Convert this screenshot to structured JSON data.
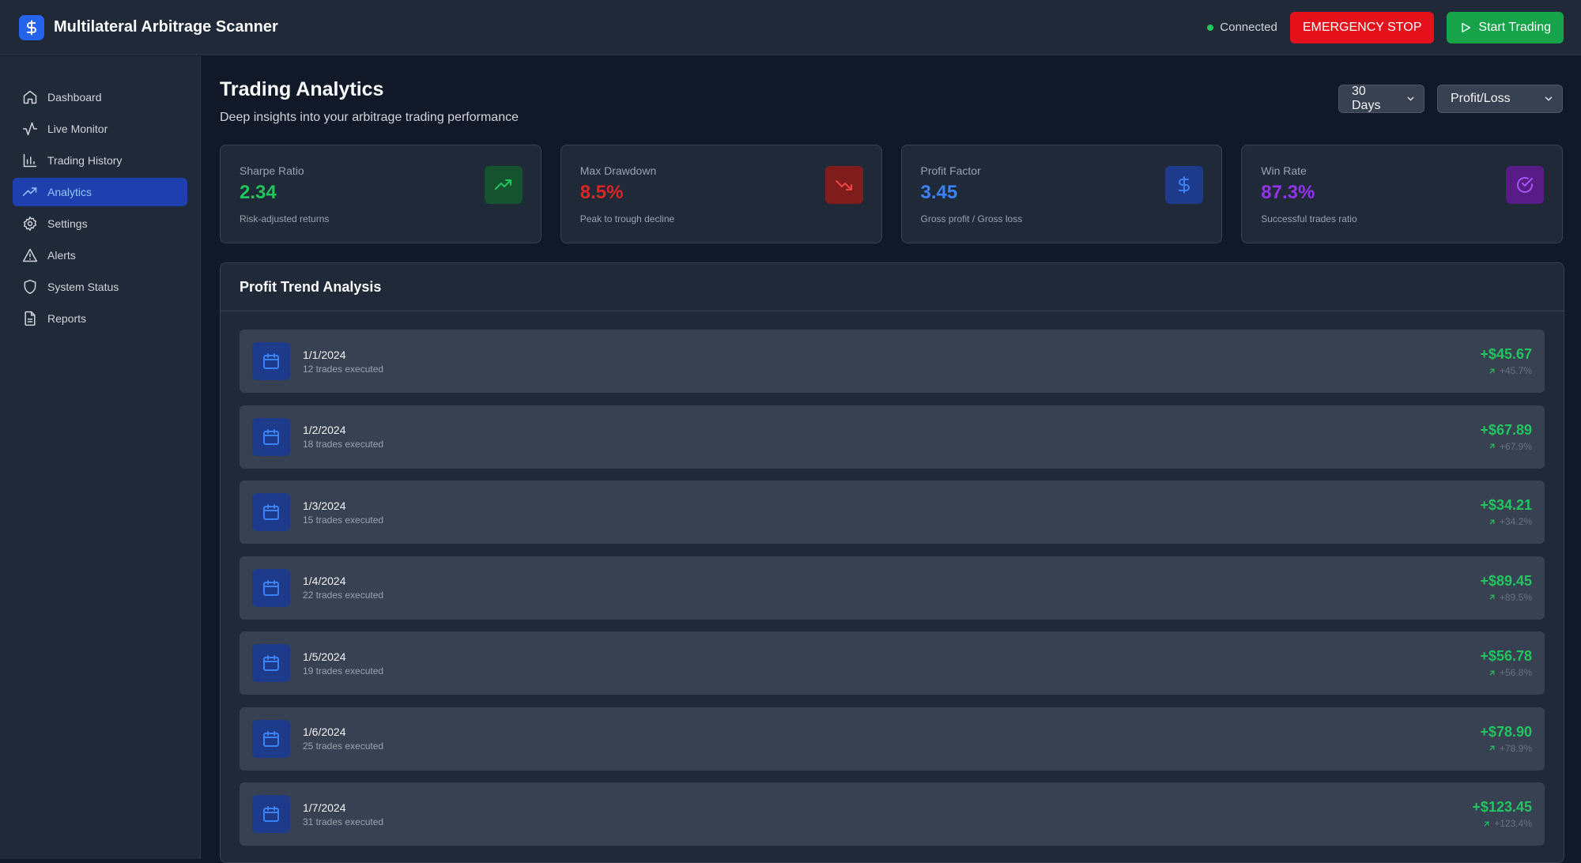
{
  "header": {
    "title": "Multilateral Arbitrage Scanner",
    "status": "Connected",
    "emergency_label": "EMERGENCY STOP",
    "start_label": "Start Trading"
  },
  "sidebar": {
    "items": [
      {
        "label": "Dashboard",
        "icon": "home-icon"
      },
      {
        "label": "Live Monitor",
        "icon": "activity-icon"
      },
      {
        "label": "Trading History",
        "icon": "bar-chart-icon"
      },
      {
        "label": "Analytics",
        "icon": "trending-up-icon",
        "active": true
      },
      {
        "label": "Settings",
        "icon": "gear-icon"
      },
      {
        "label": "Alerts",
        "icon": "warning-icon"
      },
      {
        "label": "System Status",
        "icon": "shield-icon"
      },
      {
        "label": "Reports",
        "icon": "file-icon"
      }
    ]
  },
  "main": {
    "title": "Trading Analytics",
    "subtitle": "Deep insights into your arbitrage trading performance",
    "period_select": "30 Days",
    "metric_select": "Profit/Loss"
  },
  "stats": [
    {
      "label": "Sharpe Ratio",
      "value": "2.34",
      "desc": "Risk-adjusted returns",
      "color": "#22c55e",
      "icon": "trending-up-icon"
    },
    {
      "label": "Max Drawdown",
      "value": "8.5%",
      "desc": "Peak to trough decline",
      "color": "#dc2626",
      "icon": "trending-down-icon"
    },
    {
      "label": "Profit Factor",
      "value": "3.45",
      "desc": "Gross profit / Gross loss",
      "color": "#3b82f6",
      "icon": "dollar-icon"
    },
    {
      "label": "Win Rate",
      "value": "87.3%",
      "desc": "Successful trades ratio",
      "color": "#9333ea",
      "icon": "check-circle-icon"
    }
  ],
  "trend": {
    "title": "Profit Trend Analysis",
    "rows": [
      {
        "date": "1/1/2024",
        "trades": "12 trades executed",
        "amount": "+$45.67",
        "pct": "+45.7%"
      },
      {
        "date": "1/2/2024",
        "trades": "18 trades executed",
        "amount": "+$67.89",
        "pct": "+67.9%"
      },
      {
        "date": "1/3/2024",
        "trades": "15 trades executed",
        "amount": "+$34.21",
        "pct": "+34.2%"
      },
      {
        "date": "1/4/2024",
        "trades": "22 trades executed",
        "amount": "+$89.45",
        "pct": "+89.5%"
      },
      {
        "date": "1/5/2024",
        "trades": "19 trades executed",
        "amount": "+$56.78",
        "pct": "+56.8%"
      },
      {
        "date": "1/6/2024",
        "trades": "25 trades executed",
        "amount": "+$78.90",
        "pct": "+78.9%"
      },
      {
        "date": "1/7/2024",
        "trades": "31 trades executed",
        "amount": "+$123.45",
        "pct": "+123.4%"
      }
    ]
  }
}
